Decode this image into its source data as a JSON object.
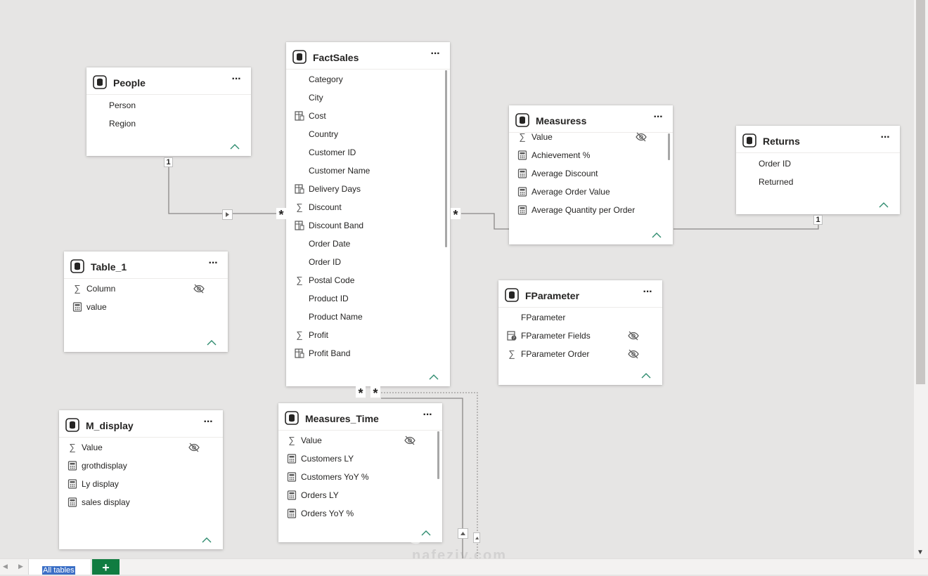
{
  "tables": {
    "people": {
      "title": "People",
      "fields": [
        {
          "name": "Person",
          "icon": ""
        },
        {
          "name": "Region",
          "icon": ""
        }
      ]
    },
    "factsales": {
      "title": "FactSales",
      "fields": [
        {
          "name": "Category",
          "icon": ""
        },
        {
          "name": "City",
          "icon": ""
        },
        {
          "name": "Cost",
          "icon": "calc-column-icon"
        },
        {
          "name": "Country",
          "icon": ""
        },
        {
          "name": "Customer ID",
          "icon": ""
        },
        {
          "name": "Customer Name",
          "icon": ""
        },
        {
          "name": "Delivery Days",
          "icon": "calc-column-icon"
        },
        {
          "name": "Discount",
          "icon": "sigma-icon"
        },
        {
          "name": "Discount Band",
          "icon": "calc-column-icon"
        },
        {
          "name": "Order Date",
          "icon": ""
        },
        {
          "name": "Order ID",
          "icon": ""
        },
        {
          "name": "Postal Code",
          "icon": "sigma-icon"
        },
        {
          "name": "Product ID",
          "icon": ""
        },
        {
          "name": "Product Name",
          "icon": ""
        },
        {
          "name": "Profit",
          "icon": "sigma-icon"
        },
        {
          "name": "Profit Band",
          "icon": "calc-column-icon"
        }
      ]
    },
    "measuress": {
      "title": "Measuress",
      "fields": [
        {
          "name": "Value",
          "icon": "sigma-icon",
          "hidden": true
        },
        {
          "name": "Achievement %",
          "icon": "measure-icon"
        },
        {
          "name": "Average Discount",
          "icon": "measure-icon"
        },
        {
          "name": "Average Order Value",
          "icon": "measure-icon"
        },
        {
          "name": "Average Quantity per Order",
          "icon": "measure-icon"
        }
      ]
    },
    "returns": {
      "title": "Returns",
      "fields": [
        {
          "name": "Order ID",
          "icon": ""
        },
        {
          "name": "Returned",
          "icon": ""
        }
      ]
    },
    "table1": {
      "title": "Table_1",
      "fields": [
        {
          "name": "Column",
          "icon": "sigma-icon",
          "hidden": true
        },
        {
          "name": "value",
          "icon": "measure-icon"
        }
      ]
    },
    "fparameter": {
      "title": "FParameter",
      "fields": [
        {
          "name": "FParameter",
          "icon": ""
        },
        {
          "name": "FParameter Fields",
          "icon": "parameter-fields-icon",
          "hidden": true
        },
        {
          "name": "FParameter Order",
          "icon": "sigma-icon",
          "hidden": true
        }
      ]
    },
    "mdisplay": {
      "title": "M_display",
      "fields": [
        {
          "name": "Value",
          "icon": "sigma-icon",
          "hidden": true
        },
        {
          "name": "grothdisplay",
          "icon": "measure-icon"
        },
        {
          "name": "Ly display",
          "icon": "measure-icon"
        },
        {
          "name": "sales display",
          "icon": "measure-icon"
        }
      ]
    },
    "measurestime": {
      "title": "Measures_Time",
      "fields": [
        {
          "name": "Value",
          "icon": "sigma-icon",
          "hidden": true
        },
        {
          "name": "Customers LY",
          "icon": "measure-icon"
        },
        {
          "name": "Customers YoY %",
          "icon": "measure-icon"
        },
        {
          "name": "Orders LY",
          "icon": "measure-icon"
        },
        {
          "name": "Orders YoY %",
          "icon": "measure-icon"
        }
      ]
    }
  },
  "relationships": {
    "people_one": "1",
    "returns_one": "1",
    "many": "*"
  },
  "bottom_bar": {
    "all_tables_tab": "All tables",
    "add_tab": "+"
  },
  "watermark": "nafeziy.com",
  "colors": {
    "canvas": "#e6e5e4",
    "card": "#ffffff",
    "add_tab": "#107c41",
    "collapse": "#2e8b6e"
  }
}
